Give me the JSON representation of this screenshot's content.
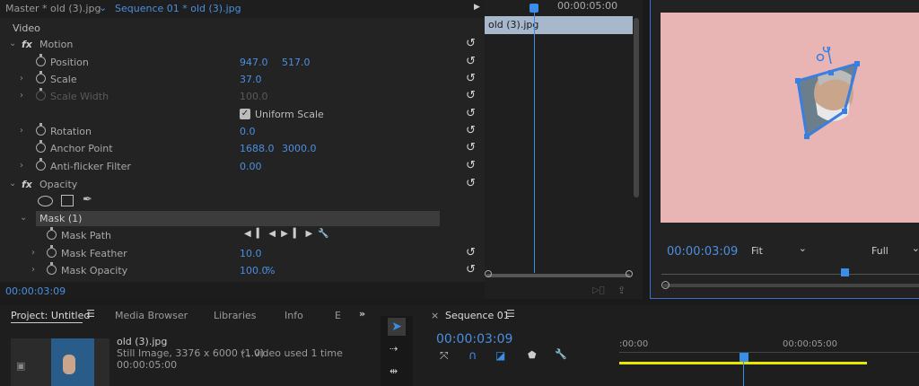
{
  "tabs": {
    "master": "Master * old (3).jpg",
    "sequence": "Sequence 01 * old (3).jpg"
  },
  "effect_controls": {
    "section": "Video",
    "motion": "Motion",
    "position": {
      "label": "Position",
      "x": "947.0",
      "y": "517.0"
    },
    "scale": {
      "label": "Scale",
      "value": "37.0"
    },
    "scale_width": {
      "label": "Scale Width",
      "value": "100.0"
    },
    "uniform_scale": "Uniform Scale",
    "rotation": {
      "label": "Rotation",
      "value": "0.0"
    },
    "anchor_point": {
      "label": "Anchor Point",
      "x": "1688.0",
      "y": "3000.0"
    },
    "anti_flicker": {
      "label": "Anti-flicker Filter",
      "value": "0.00"
    },
    "opacity": "Opacity",
    "mask": "Mask (1)",
    "mask_path": "Mask Path",
    "mask_feather": {
      "label": "Mask Feather",
      "value": "10.0"
    },
    "mask_opacity": {
      "label": "Mask Opacity",
      "value": "100.0",
      "unit": "%"
    },
    "timecode": "00:00:03:09"
  },
  "mini_timeline": {
    "time_label": "00:00:05:00",
    "clip": "old (3).jpg"
  },
  "program": {
    "timecode": "00:00:03:09",
    "fit": "Fit",
    "quality": "Full"
  },
  "project": {
    "tab": "Project: Untitled",
    "tabs": [
      "Media Browser",
      "Libraries",
      "Info",
      "E"
    ],
    "clip_name": "old (3).jpg",
    "clip_info": "Still Image, 3376 x 6000 (1.0)",
    "clip_usage": ", video used 1 time",
    "clip_duration": "00:00:05:00"
  },
  "sequence_panel": {
    "tab": "Sequence 01",
    "timecode": "00:00:03:09",
    "t0": ":00:00",
    "t1": "00:00:05:00"
  },
  "colors": {
    "accent": "#4a8fe0",
    "preview_bg": "#e8b4b4",
    "timeline_bar": "#e6e600"
  }
}
